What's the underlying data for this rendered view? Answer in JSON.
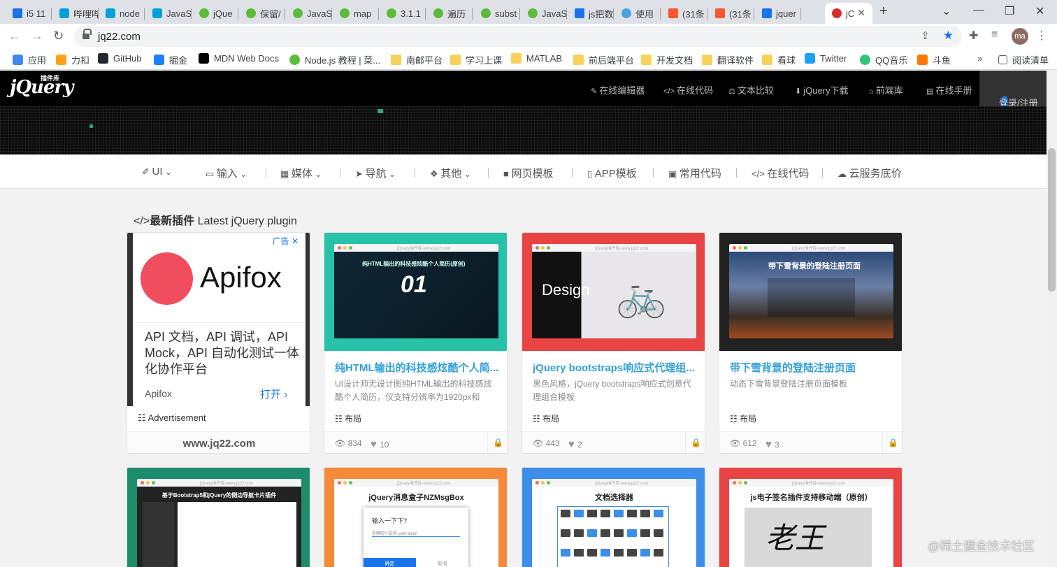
{
  "browser": {
    "tabs": [
      {
        "label": "i5 11",
        "icon": "bing-icon"
      },
      {
        "label": "哔哩哔",
        "icon": "bilibili-icon"
      },
      {
        "label": "node",
        "icon": "bilibili-icon"
      },
      {
        "label": "JavaS",
        "icon": "bilibili-icon"
      },
      {
        "label": "jQue",
        "icon": "frog-icon"
      },
      {
        "label": "保留/",
        "icon": "frog-icon"
      },
      {
        "label": "JavaS",
        "icon": "frog-icon"
      },
      {
        "label": "map",
        "icon": "frog-icon"
      },
      {
        "label": "3.1.1",
        "icon": "frog-icon"
      },
      {
        "label": "遍历",
        "icon": "frog-icon"
      },
      {
        "label": "subst",
        "icon": "frog-icon"
      },
      {
        "label": "JavaS",
        "icon": "frog-icon"
      },
      {
        "label": "js把数",
        "icon": "bing-icon"
      },
      {
        "label": "使用",
        "icon": "cloud-icon"
      },
      {
        "label": "(31条",
        "icon": "csdn-icon"
      },
      {
        "label": "(31条",
        "icon": "csdn-icon"
      },
      {
        "label": "jquer",
        "icon": "bing-icon"
      },
      {
        "label": "jC",
        "icon": "jq22-icon"
      }
    ],
    "url": "jq22.com",
    "avatar": "ma",
    "bookmarks": [
      {
        "label": "应用"
      },
      {
        "label": "力扣"
      },
      {
        "label": "GitHub"
      },
      {
        "label": "掘金"
      },
      {
        "label": "MDN Web Docs"
      },
      {
        "label": "Node.js 教程 | 菜..."
      },
      {
        "label": "南邮平台"
      },
      {
        "label": "学习上课"
      },
      {
        "label": "MATLAB"
      },
      {
        "label": "前后端平台"
      },
      {
        "label": "开发文档"
      },
      {
        "label": "翻译软件"
      },
      {
        "label": "看球"
      },
      {
        "label": "Twitter"
      },
      {
        "label": "QQ音乐"
      },
      {
        "label": "斗鱼"
      }
    ],
    "reading_list": "阅读清单",
    "more": "»"
  },
  "site": {
    "logo": "jQuery",
    "logo_sub": "插件库",
    "topnav": [
      "在线编辑器",
      "在线代码",
      "文本比较",
      "jQuery下载",
      "前端库",
      "在线手册"
    ],
    "login": "登录/注册",
    "categories": [
      "UI",
      "输入",
      "媒体",
      "导航",
      "其他",
      "网页模板",
      "APP模板",
      "常用代码",
      "在线代码",
      "云服务底价"
    ],
    "section_title_bold": "最新插件",
    "section_title_rest": "Latest jQuery plugin"
  },
  "ad": {
    "label": "广告",
    "brand": "Apifox",
    "body": "API 文档，API 调试，API Mock，API 自动化测试一体化协作平台",
    "source": "Apifox",
    "open": "打开",
    "footer_label": "Advertisement",
    "footer_site": "www.jq22.com"
  },
  "cards": [
    {
      "title": "纯HTML输出的科技感炫酷个人简...",
      "desc": "UI设计师无设计图纯HTML输出的科技感炫酷个人简历，仅支持分辨率为1920px和",
      "tag": "布局",
      "views": "834",
      "likes": "10",
      "thumb_header": "纯HTML输出的科技感炫酷个人简历(原创)",
      "thumb_big": "01"
    },
    {
      "title": "jQuery bootstraps响应式代理组...",
      "desc": "黑色风格，jQuery bootstraps响应式创意代理组合模板",
      "tag": "布局",
      "views": "443",
      "likes": "2",
      "thumb_big": "Design"
    },
    {
      "title": "带下雪背景的登陆注册页面",
      "desc": "动态下雪背景登陆注册页面模板",
      "tag": "布局",
      "views": "612",
      "likes": "3",
      "thumb_header": "带下雪背景的登陆注册页面"
    }
  ],
  "cards_row2": [
    {
      "thumb_header": "基于Bootstrap5和jQuery的侧边导航卡片插件"
    },
    {
      "thumb_header": "jQuery消息盒子NZMsgBox",
      "dialog_title": "输入一下下?",
      "dialog_input": "是哪啦? 成功! well done!",
      "ok": "确定",
      "cancel": "取消"
    },
    {
      "thumb_header": "文档选择器"
    },
    {
      "thumb_header": "js电子签名插件支持移动端（原创）",
      "signature": "老王"
    }
  ],
  "win_caption": "jQuery插件库-www.jq22.com",
  "watermark": "@稀土掘金技术社区",
  "colors": {
    "accent": "#33a0d8",
    "teal": "#27c2a8",
    "red": "#e94444",
    "dark": "#222222",
    "orange": "#f58a3a",
    "blue": "#3d8ee8"
  }
}
